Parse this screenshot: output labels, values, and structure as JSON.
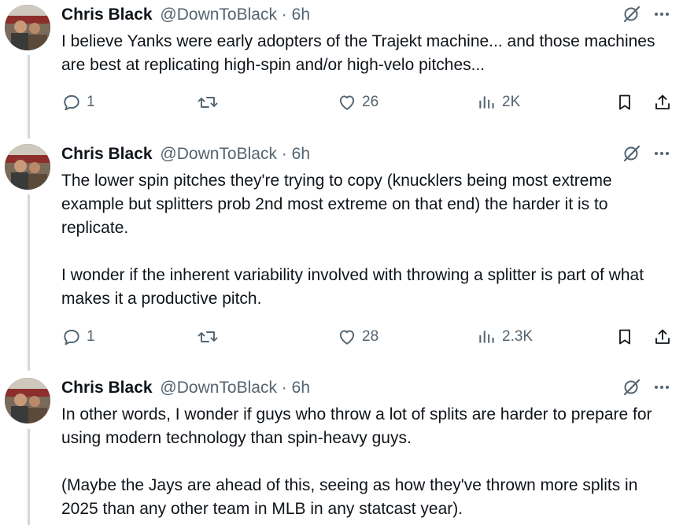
{
  "tweets": [
    {
      "author_name": "Chris Black",
      "handle": "@DownToBlack",
      "separator": "·",
      "time": "6h",
      "text": "I believe Yanks were early adopters of the Trajekt machine... and those machines are best at replicating high-spin and/or high-velo pitches...",
      "replies": "1",
      "reposts": "",
      "likes": "26",
      "views": "2K"
    },
    {
      "author_name": "Chris Black",
      "handle": "@DownToBlack",
      "separator": "·",
      "time": "6h",
      "text": "The lower spin pitches they're trying to copy (knucklers being most extreme example but splitters prob 2nd most extreme on that end) the harder it is to replicate.\n\nI wonder if the inherent variability involved with throwing a splitter is part of what makes it a productive pitch.",
      "replies": "1",
      "reposts": "",
      "likes": "28",
      "views": "2.3K"
    },
    {
      "author_name": "Chris Black",
      "handle": "@DownToBlack",
      "separator": "·",
      "time": "6h",
      "text": "In other words, I wonder if guys who throw a lot of splits are harder to prepare for using modern technology than spin-heavy guys.\n\n(Maybe the Jays are ahead of this, seeing as how they've thrown more splits in 2025 than any other team in MLB in any statcast year)."
    }
  ],
  "colors": {
    "text": "#0f1419",
    "secondary": "#536471",
    "thread_line": "#cfd9de"
  },
  "icons": [
    "grok-icon",
    "more-icon",
    "reply-icon",
    "repost-icon",
    "like-icon",
    "views-icon",
    "bookmark-icon",
    "share-icon"
  ]
}
